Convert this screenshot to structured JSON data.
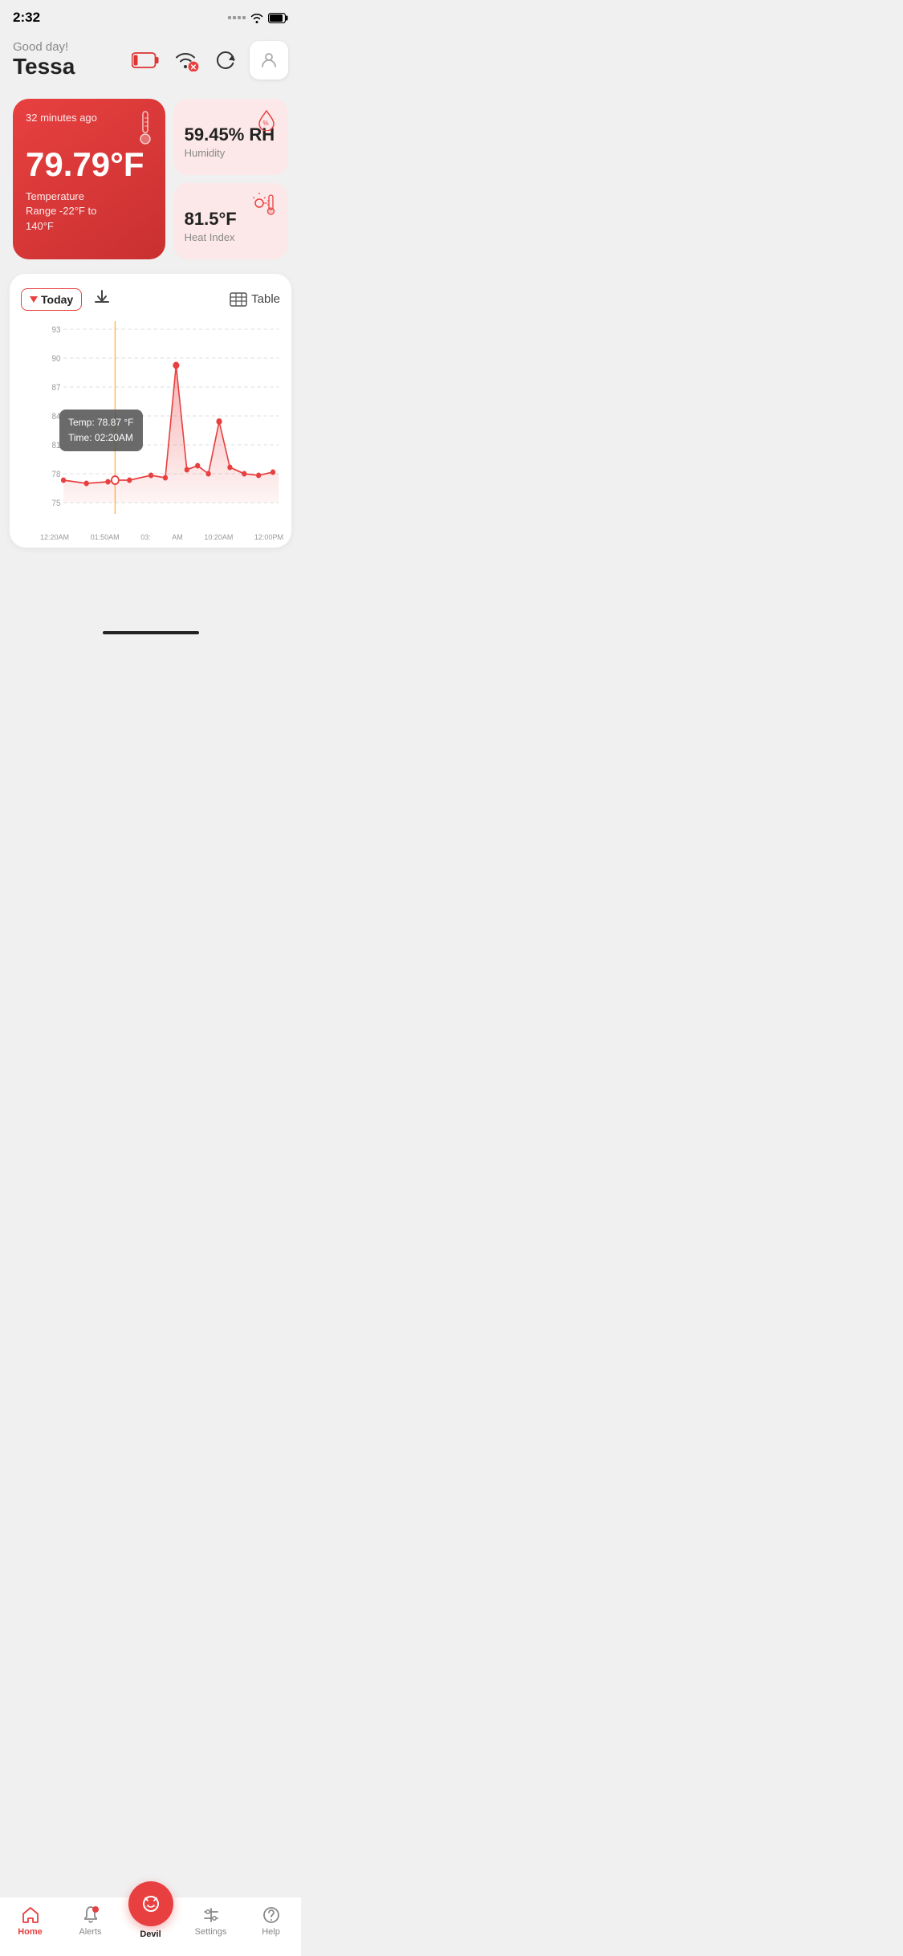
{
  "statusBar": {
    "time": "2:32",
    "signalLabel": "signal",
    "wifiLabel": "wifi",
    "batteryLabel": "battery"
  },
  "header": {
    "greeting": "Good day!",
    "userName": "Tessa",
    "batteryIconLabel": "low-battery-icon",
    "wifiErrorIconLabel": "wifi-error-icon",
    "refreshIconLabel": "refresh-icon",
    "profileIconLabel": "profile-icon"
  },
  "tempCard": {
    "timeAgo": "32 minutes ago",
    "temperature": "79.79°F",
    "label": "Temperature\nRange -22°F to\n140°F",
    "thermoIconLabel": "thermometer-icon"
  },
  "humidityCard": {
    "value": "59.45% RH",
    "label": "Humidity",
    "iconLabel": "humidity-icon"
  },
  "heatIndexCard": {
    "value": "81.5°F",
    "label": "Heat Index",
    "iconLabel": "heat-index-icon"
  },
  "chart": {
    "todayLabel": "Today",
    "downloadLabel": "download",
    "tableLabel": "Table",
    "yLabels": [
      "93",
      "90",
      "87",
      "84",
      "81",
      "78",
      "75"
    ],
    "xLabels": [
      "12:20AM",
      "01:50AM",
      "03:",
      "AM",
      "10:20AM",
      "12:00PM"
    ],
    "tooltip": {
      "tempLine": "Temp: 78.87 °F",
      "timeLine": "Time: 02:20AM"
    }
  },
  "bottomNav": {
    "items": [
      {
        "label": "Home",
        "icon": "home-icon",
        "active": true
      },
      {
        "label": "Alerts",
        "icon": "alerts-icon",
        "active": false
      },
      {
        "label": "Devil",
        "icon": "devil-icon",
        "active": false,
        "center": true
      },
      {
        "label": "Settings",
        "icon": "settings-icon",
        "active": false
      },
      {
        "label": "Help",
        "icon": "help-icon",
        "active": false
      }
    ]
  }
}
